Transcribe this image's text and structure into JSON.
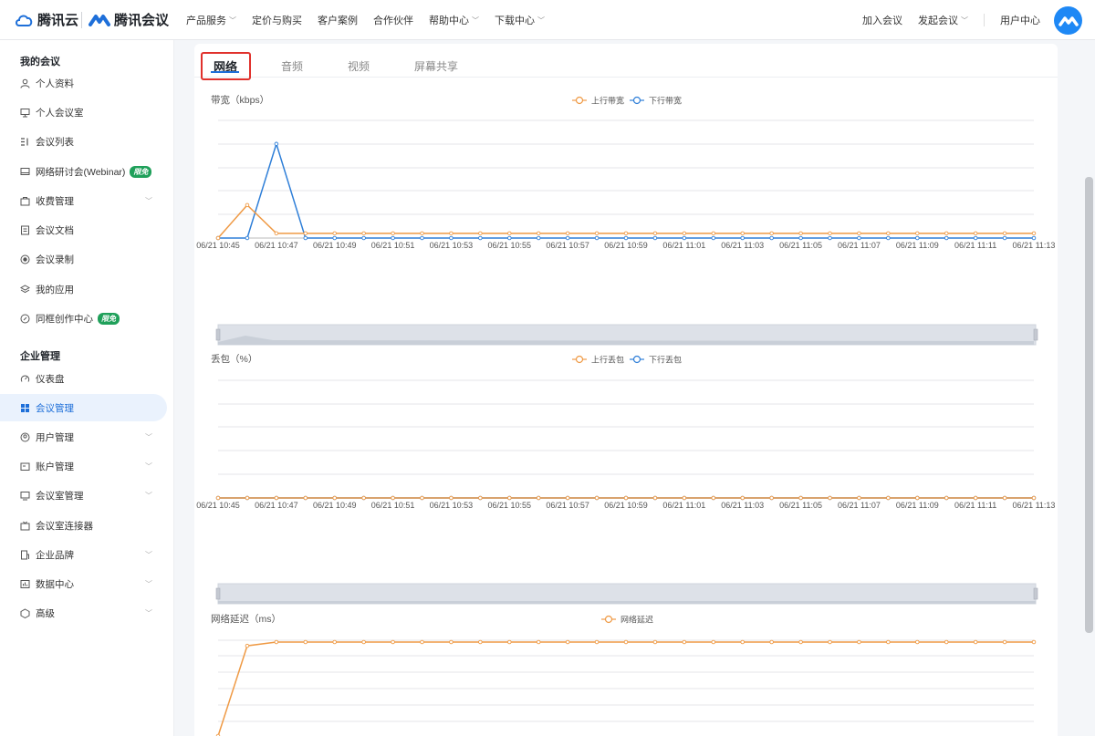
{
  "header": {
    "brand1": "腾讯云",
    "brand2": "腾讯会议",
    "nav": [
      {
        "label": "产品服务",
        "dropdown": true
      },
      {
        "label": "定价与购买",
        "dropdown": false
      },
      {
        "label": "客户案例",
        "dropdown": false
      },
      {
        "label": "合作伙伴",
        "dropdown": false
      },
      {
        "label": "帮助中心",
        "dropdown": true
      },
      {
        "label": "下载中心",
        "dropdown": true
      }
    ],
    "right": {
      "join": "加入会议",
      "start": "发起会议",
      "user_center": "用户中心"
    }
  },
  "sidebar": {
    "section1": "我的会议",
    "section2": "企业管理",
    "items": [
      {
        "label": "个人资料",
        "icon": "user-icon"
      },
      {
        "label": "个人会议室",
        "icon": "room-icon"
      },
      {
        "label": "会议列表",
        "icon": "list-icon"
      },
      {
        "label": "网络研讨会(Webinar)",
        "icon": "webinar-icon",
        "badge": "限免"
      },
      {
        "label": "收费管理",
        "icon": "billing-icon",
        "chevron": true
      },
      {
        "label": "会议文档",
        "icon": "document-icon"
      },
      {
        "label": "会议录制",
        "icon": "record-icon"
      },
      {
        "label": "我的应用",
        "icon": "apps-icon"
      },
      {
        "label": "同框创作中心",
        "icon": "create-icon",
        "badge": "限免"
      },
      {
        "label": "仪表盘",
        "icon": "dashboard-icon"
      },
      {
        "label": "会议管理",
        "icon": "grid-icon",
        "active": true
      },
      {
        "label": "用户管理",
        "icon": "user-manage-icon",
        "chevron": true
      },
      {
        "label": "账户管理",
        "icon": "account-icon",
        "chevron": true
      },
      {
        "label": "会议室管理",
        "icon": "meeting-room-icon",
        "chevron": true
      },
      {
        "label": "会议室连接器",
        "icon": "connector-icon"
      },
      {
        "label": "企业品牌",
        "icon": "brand-icon",
        "chevron": true
      },
      {
        "label": "数据中心",
        "icon": "data-icon",
        "chevron": true
      },
      {
        "label": "高级",
        "icon": "advanced-icon",
        "chevron": true
      }
    ]
  },
  "tabs": [
    "网络",
    "音频",
    "视频",
    "屏幕共享"
  ],
  "active_tab": "网络",
  "colors": {
    "upstream": "#ef9a45",
    "downstream": "#2f7fd8",
    "accent": "#1e6fd9",
    "highlight_box": "#e0312c"
  },
  "chart_data": [
    {
      "type": "line",
      "title": "带宽（kbps）",
      "x": [
        "06/21 10:45",
        "06/21 10:46",
        "06/21 10:47",
        "06/21 10:48",
        "06/21 10:49",
        "06/21 10:50",
        "06/21 10:51",
        "06/21 10:52",
        "06/21 10:53",
        "06/21 10:54",
        "06/21 10:55",
        "06/21 10:56",
        "06/21 10:57",
        "06/21 10:58",
        "06/21 10:59",
        "06/21 11:00",
        "06/21 11:01",
        "06/21 11:02",
        "06/21 11:03",
        "06/21 11:04",
        "06/21 11:05",
        "06/21 11:06",
        "06/21 11:07",
        "06/21 11:08",
        "06/21 11:09",
        "06/21 11:10",
        "06/21 11:11",
        "06/21 11:12",
        "06/21 11:13"
      ],
      "x_tick_labels": [
        "06/21 10:45",
        "06/21 10:47",
        "06/21 10:49",
        "06/21 10:51",
        "06/21 10:53",
        "06/21 10:55",
        "06/21 10:57",
        "06/21 10:59",
        "06/21 11:01",
        "06/21 11:03",
        "06/21 11:05",
        "06/21 11:07",
        "06/21 11:09",
        "06/21 11:11",
        "06/21 11:13"
      ],
      "series": [
        {
          "name": "上行带宽",
          "color": "#ef9a45",
          "values": [
            0,
            35,
            5,
            5,
            5,
            5,
            5,
            5,
            5,
            5,
            5,
            5,
            5,
            5,
            5,
            5,
            5,
            5,
            5,
            5,
            5,
            5,
            5,
            5,
            5,
            5,
            5,
            5,
            5
          ]
        },
        {
          "name": "下行带宽",
          "color": "#2f7fd8",
          "values": [
            0,
            0,
            100,
            0,
            0,
            0,
            0,
            0,
            0,
            0,
            0,
            0,
            0,
            0,
            0,
            0,
            0,
            0,
            0,
            0,
            0,
            0,
            0,
            0,
            0,
            0,
            0,
            0,
            0
          ]
        }
      ],
      "ylim": [
        0,
        125
      ],
      "grid": true,
      "legend": "top-center",
      "show_zoom_slider": true
    },
    {
      "type": "line",
      "title": "丢包（%）",
      "x": [
        "06/21 10:45",
        "06/21 10:46",
        "06/21 10:47",
        "06/21 10:48",
        "06/21 10:49",
        "06/21 10:50",
        "06/21 10:51",
        "06/21 10:52",
        "06/21 10:53",
        "06/21 10:54",
        "06/21 10:55",
        "06/21 10:56",
        "06/21 10:57",
        "06/21 10:58",
        "06/21 10:59",
        "06/21 11:00",
        "06/21 11:01",
        "06/21 11:02",
        "06/21 11:03",
        "06/21 11:04",
        "06/21 11:05",
        "06/21 11:06",
        "06/21 11:07",
        "06/21 11:08",
        "06/21 11:09",
        "06/21 11:10",
        "06/21 11:11",
        "06/21 11:12",
        "06/21 11:13"
      ],
      "x_tick_labels": [
        "06/21 10:45",
        "06/21 10:47",
        "06/21 10:49",
        "06/21 10:51",
        "06/21 10:53",
        "06/21 10:55",
        "06/21 10:57",
        "06/21 10:59",
        "06/21 11:01",
        "06/21 11:03",
        "06/21 11:05",
        "06/21 11:07",
        "06/21 11:09",
        "06/21 11:11",
        "06/21 11:13"
      ],
      "series": [
        {
          "name": "上行丢包",
          "color": "#ef9a45",
          "values": [
            0,
            0,
            0,
            0,
            0,
            0,
            0,
            0,
            0,
            0,
            0,
            0,
            0,
            0,
            0,
            0,
            0,
            0,
            0,
            0,
            0,
            0,
            0,
            0,
            0,
            0,
            0,
            0,
            0
          ]
        },
        {
          "name": "下行丢包",
          "color": "#2f7fd8",
          "values": [
            0,
            0,
            0,
            0,
            0,
            0,
            0,
            0,
            0,
            0,
            0,
            0,
            0,
            0,
            0,
            0,
            0,
            0,
            0,
            0,
            0,
            0,
            0,
            0,
            0,
            0,
            0,
            0,
            0
          ]
        }
      ],
      "ylim": [
        0,
        100
      ],
      "grid": true,
      "legend": "top-center",
      "show_zoom_slider": true
    },
    {
      "type": "line",
      "title": "网络延迟（ms）",
      "x": [
        "06/21 10:45",
        "06/21 10:46",
        "06/21 10:47",
        "06/21 10:48",
        "06/21 10:49",
        "06/21 10:50",
        "06/21 10:51",
        "06/21 10:52",
        "06/21 10:53",
        "06/21 10:54",
        "06/21 10:55",
        "06/21 10:56",
        "06/21 10:57",
        "06/21 10:58",
        "06/21 10:59",
        "06/21 11:00",
        "06/21 11:01",
        "06/21 11:02",
        "06/21 11:03",
        "06/21 11:04",
        "06/21 11:05",
        "06/21 11:06",
        "06/21 11:07",
        "06/21 11:08",
        "06/21 11:09",
        "06/21 11:10",
        "06/21 11:11",
        "06/21 11:12",
        "06/21 11:13"
      ],
      "series": [
        {
          "name": "网络延迟",
          "color": "#ef9a45",
          "values": [
            0,
            96,
            100,
            100,
            100,
            100,
            100,
            100,
            100,
            100,
            100,
            100,
            100,
            100,
            100,
            100,
            100,
            100,
            100,
            100,
            100,
            100,
            100,
            100,
            100,
            100,
            100,
            100,
            100
          ]
        }
      ],
      "ylim": [
        0,
        100
      ],
      "grid": true,
      "legend": "top-center"
    }
  ]
}
